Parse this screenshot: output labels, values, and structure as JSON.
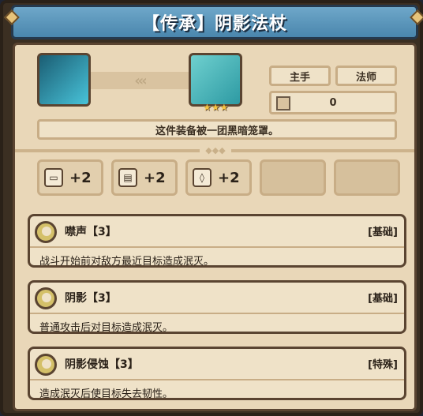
{
  "title": "【传承】阴影法杖",
  "item": {
    "slot_label": "主手",
    "class_label": "法师",
    "value": "0",
    "stars": "★★★",
    "description": "这件装备被一团黑暗笼罩。",
    "arrows": "‹‹‹"
  },
  "stats": [
    {
      "icon": "book-icon",
      "glyph": "▭",
      "value": "+2"
    },
    {
      "icon": "scroll-icon",
      "glyph": "▤",
      "value": "+2"
    },
    {
      "icon": "feather-icon",
      "glyph": "◊",
      "value": "+2"
    }
  ],
  "skills": [
    {
      "name": "噤声【3】",
      "tag": "[基础]",
      "text": "战斗开始前对敌方最近目标造成泯灭。"
    },
    {
      "name": "阴影【3】",
      "tag": "[基础]",
      "text": "普通攻击后对目标造成泯灭。"
    },
    {
      "name": "阴影侵蚀【3】",
      "tag": "[特殊]",
      "text": "造成泯灭后使目标失去韧性。"
    }
  ]
}
